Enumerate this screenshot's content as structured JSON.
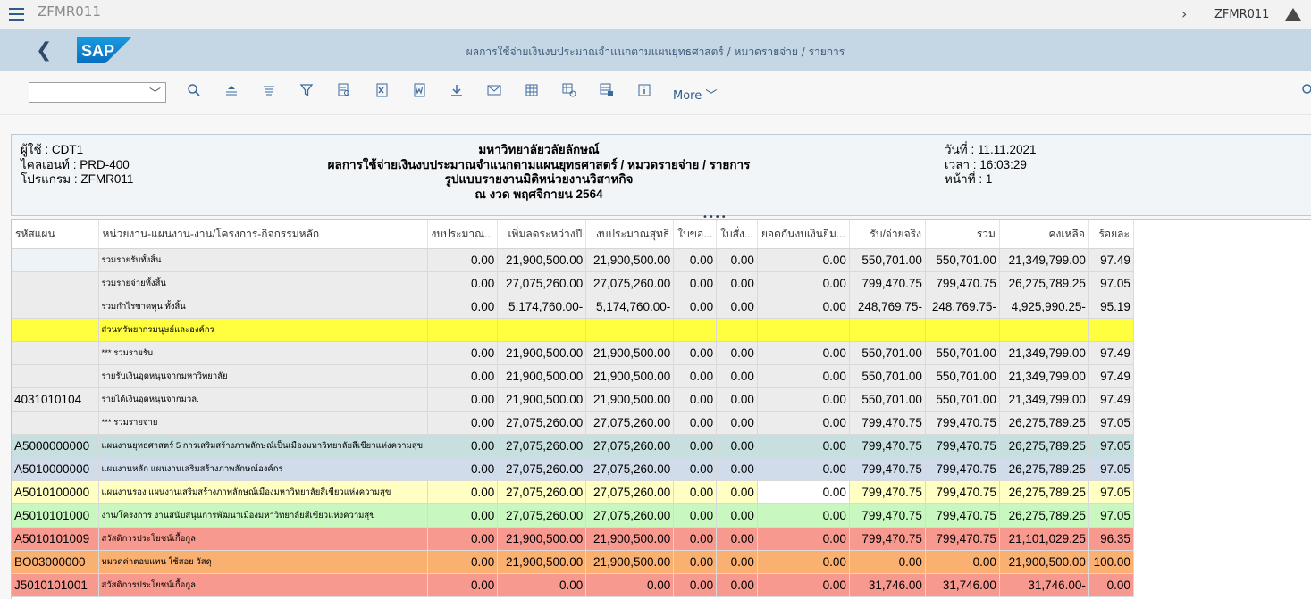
{
  "shell": {
    "title": "ZFMR011",
    "right_title": "ZFMR011"
  },
  "header": {
    "title": "ผลการใช้จ่ายเงินงบประมาณจำแนกตามแผนยุทธศาสตร์ / หมวดรายจ่าย / รายการ",
    "logo_text": "SAP"
  },
  "toolbar": {
    "combo_value": "",
    "more_label": "More",
    "icons": [
      "search-icon",
      "sort-ascending-icon",
      "sort-descending-icon",
      "filter-icon",
      "print-preview-icon",
      "excel-export-icon",
      "word-export-icon",
      "download-icon",
      "mail-icon",
      "grid-layout-icon",
      "layout-settings-icon",
      "abc-analysis-icon",
      "info-icon"
    ]
  },
  "report_header": {
    "left": [
      "ผู้ใช้ : CDT1",
      "ไคลเอนท์ : PRD-400",
      "โปรแกรม : ZFMR011"
    ],
    "center": [
      "มหาวิทยาลัยวลัยลักษณ์",
      "ผลการใช้จ่ายเงินงบประมาณจำแนกตามแผนยุทธศาสตร์ / หมวดรายจ่าย / รายการ",
      "รูปแบบรายงานมิติหน่วยงานวิสาหกิจ",
      "ณ งวด พฤศจิกายน 2564"
    ],
    "right": [
      "วันที่ : 11.11.2021",
      "เวลา : 16:03:29",
      "หน้าที่ : 1"
    ]
  },
  "grid": {
    "columns": [
      "รหัสแผน",
      "หน่วยงาน-แผนงาน-งาน/โครงการ-กิจกรรมหลัก",
      "งบประมาณ...",
      "เพิ่มลดระหว่างปี",
      "งบประมาณสุทธิ",
      "ใบขอ...",
      "ใบสั่ง...",
      "ยอดกันงบเงินยืม...",
      "รับ/จ่ายจริง",
      "รวม",
      "คงเหลือ",
      "ร้อยละ"
    ],
    "rows": [
      {
        "style": "grey",
        "code": "",
        "desc": "รวมรายรับทั้งสิ้น",
        "v": [
          "0.00",
          "21,900,500.00",
          "21,900,500.00",
          "0.00",
          "0.00",
          "0.00",
          "550,701.00",
          "550,701.00",
          "21,349,799.00",
          "97.49"
        ]
      },
      {
        "style": "grey",
        "code": "",
        "desc": "รวมรายจ่ายทั้งสิ้น",
        "v": [
          "0.00",
          "27,075,260.00",
          "27,075,260.00",
          "0.00",
          "0.00",
          "0.00",
          "799,470.75",
          "799,470.75",
          "26,275,789.25",
          "97.05"
        ]
      },
      {
        "style": "grey",
        "code": "",
        "desc": "รวมกำไรขาดทุน ทั้งสิ้น",
        "v": [
          "0.00",
          "5,174,760.00-",
          "5,174,760.00-",
          "0.00",
          "0.00",
          "0.00",
          "248,769.75-",
          "248,769.75-",
          "4,925,990.25-",
          "95.19"
        ]
      },
      {
        "style": "yellow",
        "code": "",
        "desc": "ส่วนทรัพยากรมนุษย์และองค์กร",
        "v": [
          "",
          "",
          "",
          "",
          "",
          "",
          "",
          "",
          "",
          ""
        ]
      },
      {
        "style": "grey",
        "code": "",
        "desc": "*** รวมรายรับ",
        "v": [
          "0.00",
          "21,900,500.00",
          "21,900,500.00",
          "0.00",
          "0.00",
          "0.00",
          "550,701.00",
          "550,701.00",
          "21,349,799.00",
          "97.49"
        ]
      },
      {
        "style": "grey",
        "code": "",
        "desc": "รายรับเงินอุดหนุนจากมหาวิทยาลัย",
        "v": [
          "0.00",
          "21,900,500.00",
          "21,900,500.00",
          "0.00",
          "0.00",
          "0.00",
          "550,701.00",
          "550,701.00",
          "21,349,799.00",
          "97.49"
        ]
      },
      {
        "style": "grey",
        "code": "4031010104",
        "desc": "รายได้เงินอุดหนุนจากมวล.",
        "v": [
          "0.00",
          "21,900,500.00",
          "21,900,500.00",
          "0.00",
          "0.00",
          "0.00",
          "550,701.00",
          "550,701.00",
          "21,349,799.00",
          "97.49"
        ]
      },
      {
        "style": "grey",
        "code": "",
        "desc": "*** รวมรายจ่าย",
        "v": [
          "0.00",
          "27,075,260.00",
          "27,075,260.00",
          "0.00",
          "0.00",
          "0.00",
          "799,470.75",
          "799,470.75",
          "26,275,789.25",
          "97.05"
        ]
      },
      {
        "style": "teal",
        "code": "A5000000000",
        "desc": "แผนงานยุทธศาสตร์ 5 การเสริมสร้างภาพลักษณ์เป็นเมืองมหาวิทยาลัยสีเขียวแห่งความสุข",
        "v": [
          "0.00",
          "27,075,260.00",
          "27,075,260.00",
          "0.00",
          "0.00",
          "0.00",
          "799,470.75",
          "799,470.75",
          "26,275,789.25",
          "97.05"
        ]
      },
      {
        "style": "blue",
        "code": "A5010000000",
        "desc": "แผนงานหลัก แผนงานเสริมสร้างภาพลักษณ์องค์กร",
        "v": [
          "0.00",
          "27,075,260.00",
          "27,075,260.00",
          "0.00",
          "0.00",
          "0.00",
          "799,470.75",
          "799,470.75",
          "26,275,789.25",
          "97.05"
        ]
      },
      {
        "style": "lyellow",
        "code": "A5010100000",
        "desc": "แผนงานรอง แผนงานเสริมสร้างภาพลักษณ์เมืองมหาวิทยาลัยสีเขียวแห่งความสุข",
        "v": [
          "0.00",
          "27,075,260.00",
          "27,075,260.00",
          "0.00",
          "0.00",
          "0.00",
          "799,470.75",
          "799,470.75",
          "26,275,789.25",
          "97.05"
        ]
      },
      {
        "style": "green",
        "code": "A5010101000",
        "desc": "งาน/โครงการ งานสนับสนุนการพัฒนาเมืองมหาวิทยาลัยสีเขียวแห่งความสุข",
        "v": [
          "0.00",
          "27,075,260.00",
          "27,075,260.00",
          "0.00",
          "0.00",
          "0.00",
          "799,470.75",
          "799,470.75",
          "26,275,789.25",
          "97.05"
        ]
      },
      {
        "style": "red",
        "code": "A5010101009",
        "desc": "สวัสดิการประโยชน์เกื้อกูล",
        "v": [
          "0.00",
          "21,900,500.00",
          "21,900,500.00",
          "0.00",
          "0.00",
          "0.00",
          "799,470.75",
          "799,470.75",
          "21,101,029.25",
          "96.35"
        ]
      },
      {
        "style": "orange",
        "code": "BO03000000",
        "desc": "หมวดค่าตอบแทน ใช้สอย วัสดุ",
        "v": [
          "0.00",
          "21,900,500.00",
          "21,900,500.00",
          "0.00",
          "0.00",
          "0.00",
          "0.00",
          "0.00",
          "21,900,500.00",
          "100.00"
        ]
      },
      {
        "style": "red",
        "code": "J5010101001",
        "desc": "สวัสดิการประโยชน์เกื้อกูล",
        "v": [
          "0.00",
          "0.00",
          "0.00",
          "0.00",
          "0.00",
          "0.00",
          "31,746.00",
          "31,746.00",
          "31,746.00-",
          "0.00"
        ]
      }
    ]
  }
}
